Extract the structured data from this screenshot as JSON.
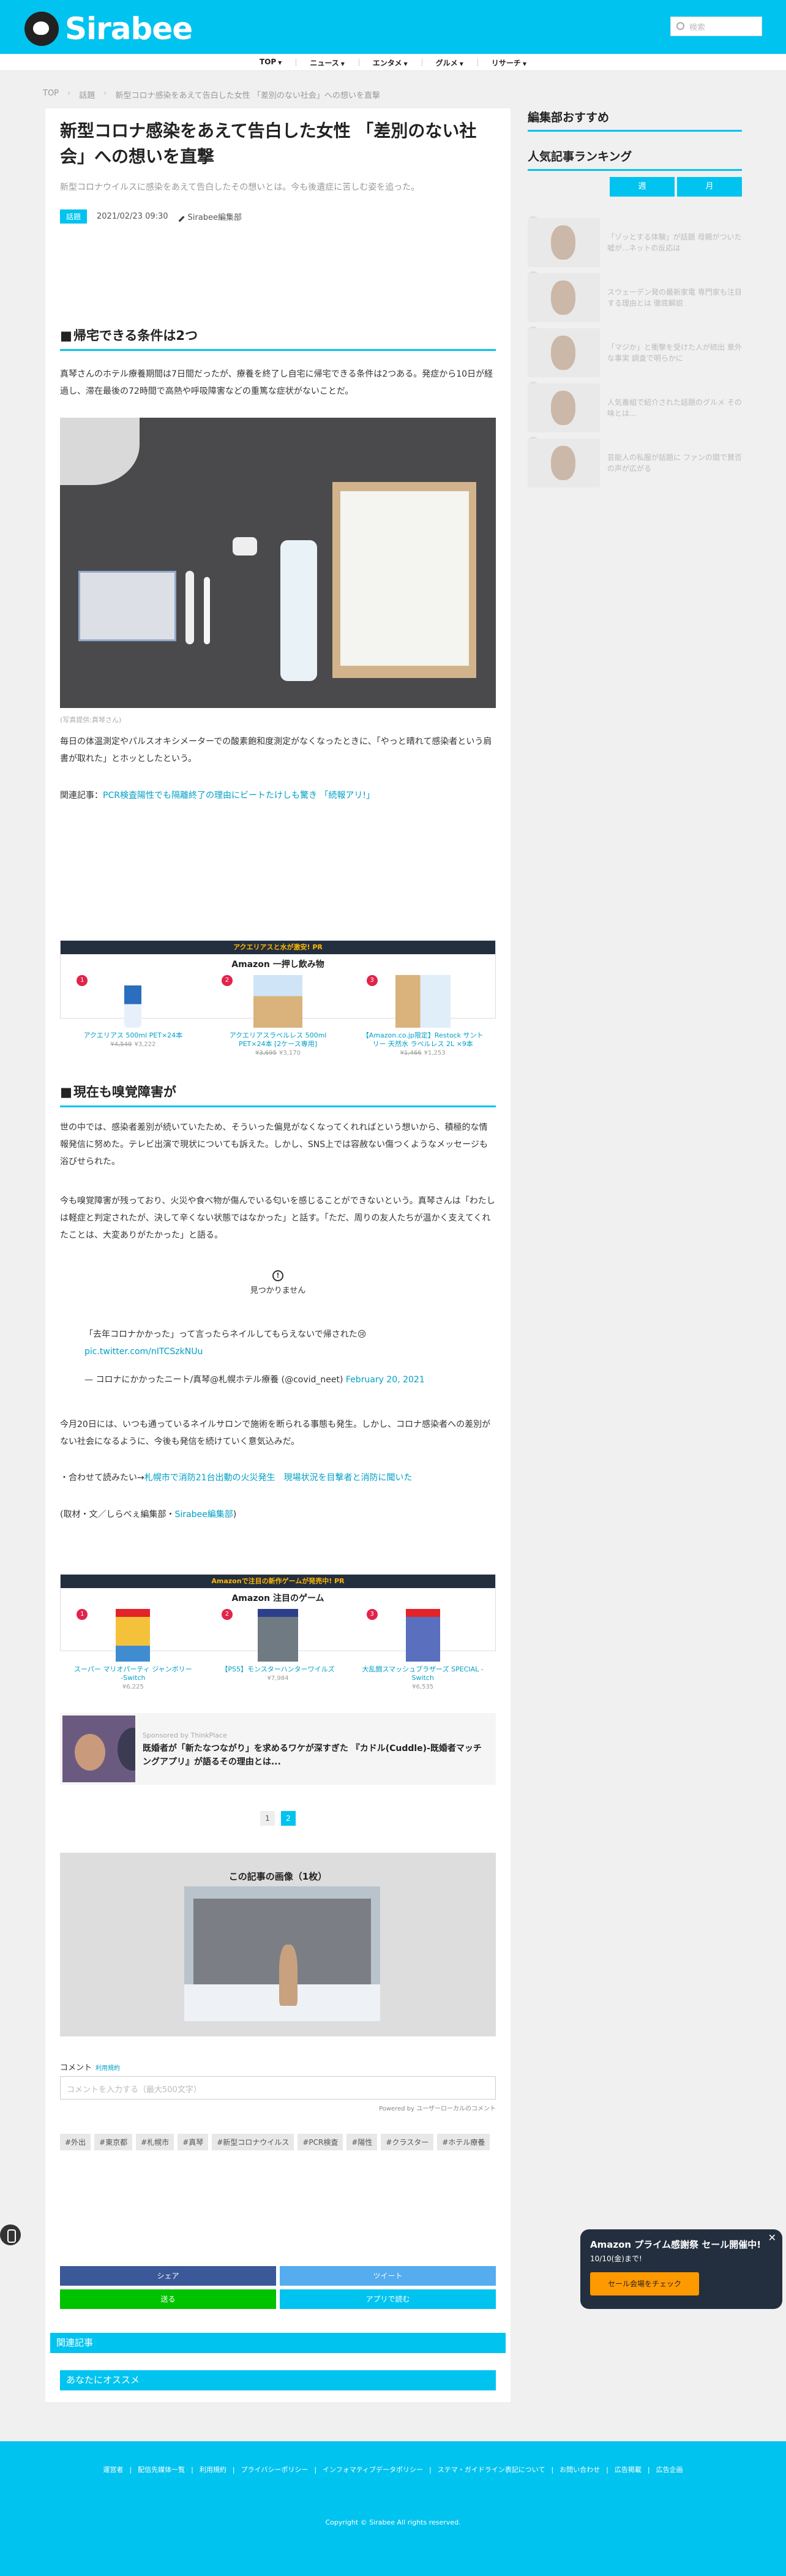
{
  "header": {
    "logo": "Sirabee",
    "search_placeholder": "検索"
  },
  "nav": [
    "TOP",
    "ニュース",
    "エンタメ",
    "グルメ",
    "リサーチ"
  ],
  "breadcrumb": [
    "TOP",
    "話題",
    "新型コロナ感染をあえて告白した女性 「差別のない社会」への想いを直撃"
  ],
  "article": {
    "title": "新型コロナ感染をあえて告白した女性 「差別のない社会」への想いを直撃",
    "lead": "新型コロナウイルスに感染をあえて告白したその想いとは。今も後遺症に苦しむ姿を追った。",
    "category": "話題",
    "date": "2021/02/23 09:30",
    "author": "Sirabee編集部",
    "h2_1": "帰宅できる条件は2つ",
    "p1": "真琴さんのホテル療養期間は7日間だったが、療養を終了し自宅に帰宅できる条件は2つある。発症から10日が経過し、滞在最後の72時間で高熱や呼吸障害などの重篤な症状がないことだ。",
    "caption": "(写真提供:真琴さん)",
    "p2": "毎日の体温測定やパルスオキシメーターでの酸素飽和度測定がなくなったときに、「やっと晴れて感染者という肩書が取れた」とホッとしたという。",
    "related_prefix": "関連記事：",
    "related_link": "PCR検査陽性でも隔離終了の理由にビートたけしも驚き 「続報アリ!」",
    "h2_2": "現在も嗅覚障害が",
    "p3": "世の中では、感染者差別が続いていたため、そういった偏見がなくなってくれればという想いから、積極的な情報発信に努めた。テレビ出演で現状についても訴えた。しかし、SNS上では容赦ない傷つくようなメッセージも浴びせられた。",
    "p4": "今も嗅覚障害が残っており、火災や食べ物が傷んでいる匂いを感じることができないという。真琴さんは「わたしは軽症と判定されたが、決して辛くない状態ではなかった」と話す。「ただ、周りの友人たちが温かく支えてくれたことは、大変ありがたかった」と語る。",
    "tweet_notfound": "見つかりません",
    "quote_text": "「去年コロナかかった」って言ったらネイルしてもらえないで帰された😢",
    "quote_link": "pic.twitter.com/nITCSzkNUu",
    "quote_author": "— コロナにかかったニート/真琴@札幌ホテル療養 (@covid_neet)",
    "quote_date": "February 20, 2021",
    "p5": "今月20日には、いつも通っているネイルサロンで施術を断られる事態も発生。しかし、コロナ感染者への差別がない社会になるように、今後も発信を続けていく意気込みだ。",
    "also_prefix": "・合わせて読みたい→",
    "also_link": "札幌市で消防21台出動の火災発生　現場状況を目撃者と消防に聞いた",
    "credit_prefix": "(取材・文／しらべぇ編集部・",
    "credit_link": "Sirabee編集部",
    "credit_suffix": ")"
  },
  "amazon1": {
    "banner": "アクエリアスと水が激安! PR",
    "title": "Amazon 一押し飲み物",
    "items": [
      {
        "rank": "1",
        "name": "アクエリアス 500ml PET×24本",
        "old": "¥4,549",
        "price": "¥3,222"
      },
      {
        "rank": "2",
        "name": "アクエリアスラベルレス 500ml PET×24本 [2ケース専用]",
        "old": "¥3,695",
        "price": "¥3,170"
      },
      {
        "rank": "3",
        "name": "【Amazon.co.jp限定】Restock サントリー 天然水 ラベルレス 2L ×9本",
        "old": "¥1,466",
        "price": "¥1,253"
      }
    ]
  },
  "amazon2": {
    "banner": "Amazonで注目の新作ゲームが発売中! PR",
    "title": "Amazon 注目のゲーム",
    "items": [
      {
        "rank": "1",
        "name": "スーパー マリオパーティ ジャンボリー -Switch",
        "price": "¥6,225"
      },
      {
        "rank": "2",
        "name": "【PS5】モンスターハンターワイルズ",
        "price": "¥7,984"
      },
      {
        "rank": "3",
        "name": "大乱闘スマッシュブラザーズ SPECIAL -Switch",
        "price": "¥6,535"
      }
    ]
  },
  "promo": {
    "sponsor": "Sponsored by ThinkPlace",
    "title": "既婚者が「新たなつながり」を求めるワケが深すぎた 『カドル(Cuddle)-既婚者マッチングアプリ』が語るその理由とは..."
  },
  "pager": [
    "1",
    "2"
  ],
  "gallery_title": "この記事の画像（1枚）",
  "comment": {
    "label": "コメント",
    "terms": "利用規約",
    "placeholder": "コメントを入力する（最大500文字）",
    "powered": "Powered by ユーザーローカルのコメント"
  },
  "tags": [
    "#外出",
    "#東京都",
    "#札幌市",
    "#真琴",
    "#新型コロナウイルス",
    "#PCR検査",
    "#陽性",
    "#クラスター",
    "#ホテル療養"
  ],
  "share": [
    "シェア",
    "ツイート",
    "送る",
    "アプリで読む"
  ],
  "sections": [
    "関連記事",
    "あなたにオススメ"
  ],
  "sidebar": {
    "recommend": "編集部おすすめ",
    "ranking": "人気記事ランキング",
    "tabs": [
      "週",
      "月"
    ],
    "items": [
      {
        "num": "1",
        "text": "「ゾッとする体験」が話題 母親がついた嘘が...ネットの反応は"
      },
      {
        "num": "2",
        "text": "スウェーデン発の最新家電 専門家も注目する理由とは 徹底解説"
      },
      {
        "num": "3",
        "text": "「マジか」と衝撃を受けた人が続出 意外な事実 調査で明らかに"
      },
      {
        "num": "4",
        "text": "人気番組で紹介された話題のグルメ その味とは..."
      },
      {
        "num": "5",
        "text": "芸能人の私服が話題に ファンの間で賛否の声が広がる"
      }
    ]
  },
  "popup": {
    "title": "Amazon プライム感謝祭 セール開催中!",
    "sub": "10/10(金)まで!",
    "button": "セール会場をチェック"
  },
  "footer": {
    "links": [
      "運営者",
      "配信先媒体一覧",
      "利用規約",
      "プライバシーポリシー",
      "インフォマティブデータポリシー",
      "ステマ・ガイドライン表記について",
      "お問い合わせ",
      "広告掲載",
      "広告企画"
    ],
    "copyright": "Copyright © Sirabee All rights reserved."
  },
  "colors": {
    "brand": "#00c3ef",
    "twitter": "#55acee",
    "facebook": "#3b5998",
    "line": "#00c300",
    "amazon": "#232f3e"
  }
}
